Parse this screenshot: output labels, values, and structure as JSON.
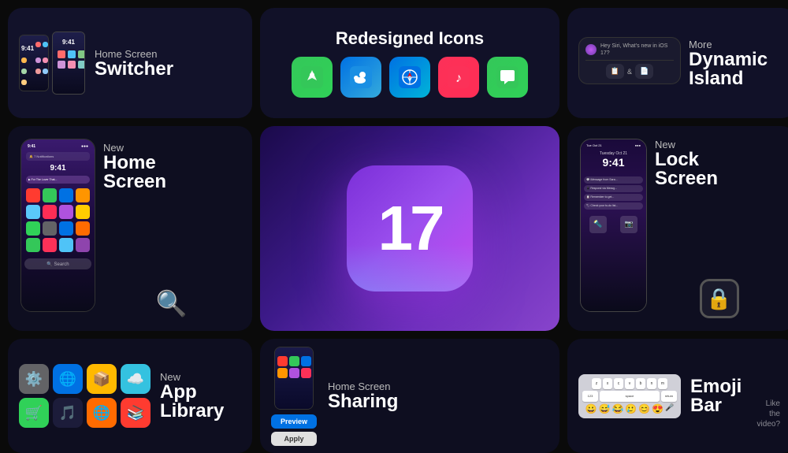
{
  "cards": {
    "switcher": {
      "label_small": "Home Screen",
      "label_large": "Switcher",
      "phone_times": [
        "9:41",
        "9:41"
      ]
    },
    "icons": {
      "title": "Redesigned Icons",
      "apps": [
        "🗺",
        "☁",
        "🧭",
        "🎵",
        "💬"
      ]
    },
    "dynamic": {
      "label_small": "More",
      "label_large": "Dynamic\nIsland",
      "siri_text": "Hey Siri, What's new in iOS 17?",
      "pill1": "📋",
      "amp": "&",
      "pill2": "📄"
    },
    "home": {
      "label_small": "New",
      "label_large": "Home\nScreen",
      "time": "9:41"
    },
    "center": {
      "number": "17"
    },
    "lock": {
      "label_small": "New",
      "label_large": "Lock\nScreen",
      "date": "Tuesday Oct 21",
      "time": "9:41"
    },
    "applibrary": {
      "label_small": "New",
      "label_large": "App\nLibrary",
      "apps": [
        "⚙️",
        "🌐",
        "📦",
        "☁️",
        "🛒",
        "🎵",
        "🌐",
        "📚"
      ]
    },
    "sharing": {
      "label_small": "Home Screen",
      "label_large": "Sharing",
      "btn_preview": "Preview",
      "btn_apply": "Apply"
    },
    "emoji": {
      "label_small": "",
      "label_large": "Emoji\nBar",
      "keys_row1": [
        "z",
        "x",
        "c",
        "v",
        "b",
        "n",
        "m"
      ],
      "keys_row2": [
        "123",
        "space",
        "return"
      ],
      "emojis": [
        "😀",
        "😅",
        "😂",
        "🥲",
        "😊",
        "😍",
        "😇"
      ]
    }
  },
  "watermark": {
    "line1": "Like",
    "line2": "the",
    "line3": "video?"
  }
}
